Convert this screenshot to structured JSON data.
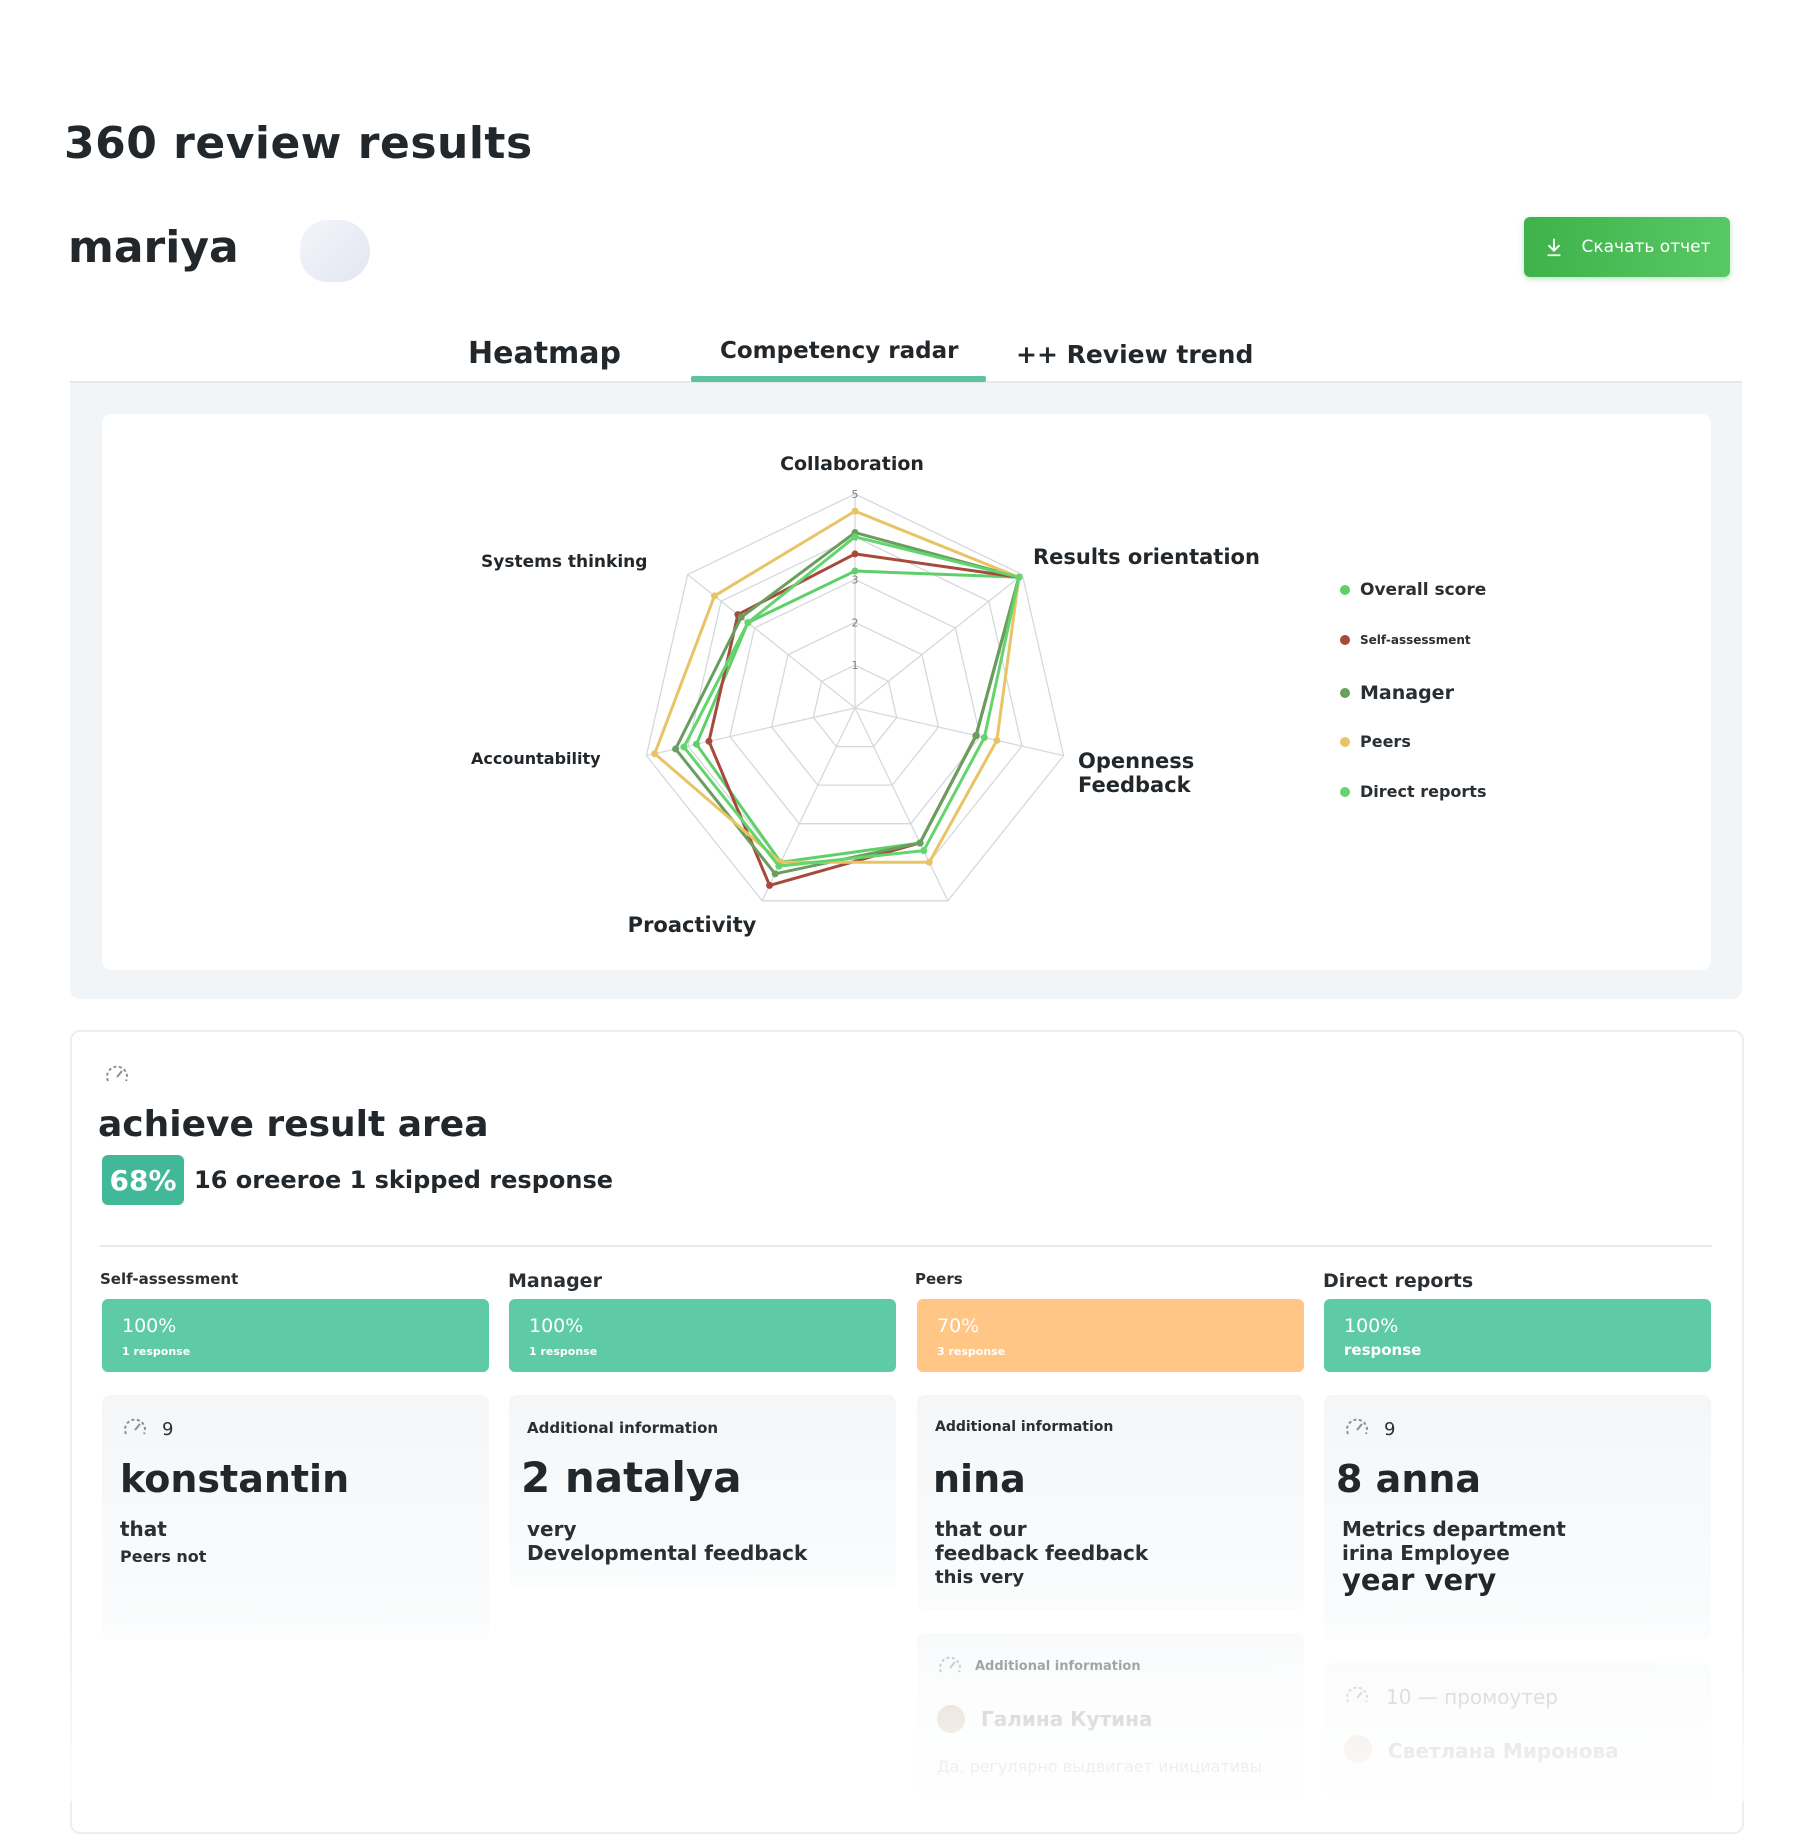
{
  "header": {
    "title": "360 review results",
    "user_name": "mariya",
    "download_label": "Скачать отчет"
  },
  "tabs": [
    {
      "label": "Heatmap",
      "active": false
    },
    {
      "label": "Competency radar",
      "active": true
    },
    {
      "label": "++ Review trend",
      "active": false
    }
  ],
  "colors": {
    "accent_green": "#4cbb58",
    "tab_underline": "#5cc49c",
    "teal_bar": "#5fcaa6",
    "orange_bar": "#ffc685"
  },
  "chart_data": {
    "type": "radar",
    "axes": [
      "Collaboration",
      "Results orientation",
      "Openness\nFeedback",
      "Proactivity",
      "Accountability",
      "Systems thinking"
    ],
    "axes_display": [
      "Collaboration",
      "Results orientation",
      "Openness",
      "Feedback",
      "Proactivity",
      "Accountability",
      "Systems thinking"
    ],
    "scale_ticks": [
      "1",
      "2",
      "3",
      "4",
      "5"
    ],
    "rmax": 5,
    "grid": true,
    "legend_position": "right",
    "series": [
      {
        "name": "Overall score",
        "color": "#5fcf6a",
        "values": [
          3.2,
          4.9,
          2.9,
          4.0,
          3.8,
          3.2
        ]
      },
      {
        "name": "Self-assessment",
        "color": "#a54a3c",
        "values": [
          3.6,
          4.9,
          2.9,
          4.6,
          3.5,
          3.5
        ]
      },
      {
        "name": "Manager",
        "color": "#6a9e5e",
        "values": [
          4.1,
          4.9,
          2.9,
          4.3,
          4.3,
          3.4
        ]
      },
      {
        "name": "Peers",
        "color": "#e8c466",
        "values": [
          4.6,
          4.9,
          3.4,
          4.0,
          4.8,
          4.2
        ]
      },
      {
        "name": "Direct reports",
        "color": "#63d46e",
        "values": [
          4.0,
          4.9,
          3.1,
          4.1,
          4.1,
          3.2
        ]
      }
    ]
  },
  "area": {
    "title": "achieve result area",
    "score": "68%",
    "summary": "16 oreeroe 1 skipped response"
  },
  "columns": [
    {
      "label": "Self-assessment",
      "pct": "100%",
      "responses": "1 response"
    },
    {
      "label": "Manager",
      "pct": "100%",
      "responses": "1 response"
    },
    {
      "label": "Peers",
      "pct": "70%",
      "responses": "3 response"
    },
    {
      "label": "Direct reports",
      "pct": "100%",
      "responses": "response"
    }
  ],
  "feedback": {
    "c1": {
      "score": "9",
      "name": "konstantin",
      "line1": "that",
      "line2": "Peers not"
    },
    "c2": {
      "header": "Additional information",
      "name": "2 natalya",
      "line1": "very",
      "line2": "Developmental feedback"
    },
    "c3": {
      "header": "Additional information",
      "name": "nina",
      "line1": "that our",
      "line2": "feedback feedback",
      "line3": "this very"
    },
    "c3b": {
      "header": "Additional information",
      "name": "Галина  Кутина",
      "text": "Да, регулярно выдвигает инициативы"
    },
    "c4": {
      "score": "9",
      "name": "8 anna",
      "line1": "Metrics department",
      "line2": "irina Employee",
      "line3": "year very"
    },
    "c4b": {
      "score": "10 — промоутер",
      "name": "Светлана  Миронова"
    }
  }
}
